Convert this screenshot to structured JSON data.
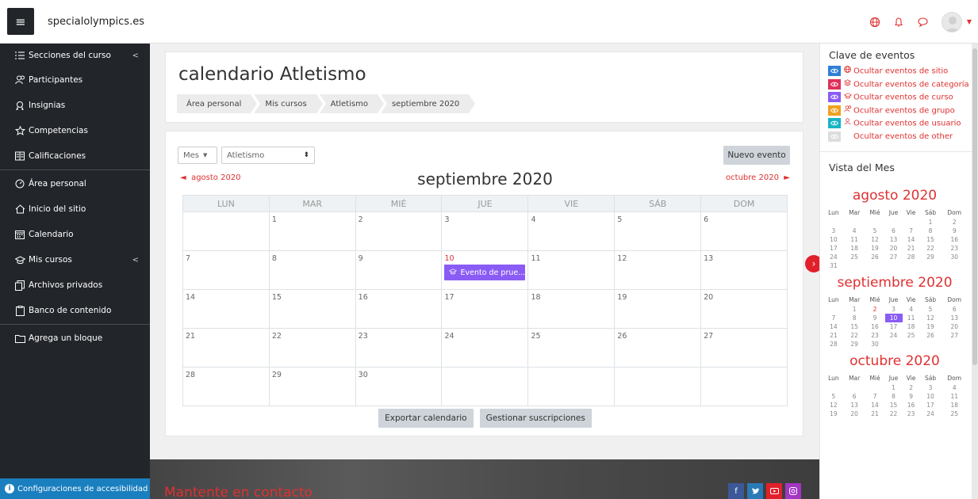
{
  "navbar": {
    "site_name": "specialolympics.es"
  },
  "sidebar": {
    "items": [
      {
        "label": "Secciones del curso",
        "icon": "list-icon",
        "chevron": "<"
      },
      {
        "label": "Participantes",
        "icon": "users-icon"
      },
      {
        "label": "Insignias",
        "icon": "badge-icon"
      },
      {
        "label": "Competencias",
        "icon": "star-icon"
      },
      {
        "label": "Calificaciones",
        "icon": "grades-icon"
      },
      {
        "label": "Área personal",
        "icon": "dashboard-icon"
      },
      {
        "label": "Inicio del sitio",
        "icon": "home-icon"
      },
      {
        "label": "Calendario",
        "icon": "calendar-icon"
      },
      {
        "label": "Mis cursos",
        "icon": "graduation-cap-icon",
        "chevron": "<"
      },
      {
        "label": "Archivos privados",
        "icon": "files-icon"
      },
      {
        "label": "Banco de contenido",
        "icon": "clipboard-icon"
      },
      {
        "label": "Agrega un bloque",
        "icon": "add-block-icon"
      }
    ],
    "accessibility_label": "Configuraciones de accesibilidad"
  },
  "header": {
    "title": "calendario Atletismo",
    "breadcrumb": [
      "Área personal",
      "Mis cursos",
      "Atletismo",
      "septiembre 2020"
    ]
  },
  "calendar": {
    "view_select": "Mes",
    "course_select": "Atletismo",
    "new_event_label": "Nuevo evento",
    "prev_month": "agosto 2020",
    "next_month": "octubre 2020",
    "month_title": "septiembre 2020",
    "weekdays": [
      "LUN",
      "MAR",
      "MIÉ",
      "JUE",
      "VIE",
      "SÁB",
      "DOM"
    ],
    "weeks": [
      [
        "",
        "1",
        "2",
        "3",
        "4",
        "5",
        "6"
      ],
      [
        "7",
        "8",
        "9",
        "10",
        "11",
        "12",
        "13"
      ],
      [
        "14",
        "15",
        "16",
        "17",
        "18",
        "19",
        "20"
      ],
      [
        "21",
        "22",
        "23",
        "24",
        "25",
        "26",
        "27"
      ],
      [
        "28",
        "29",
        "30",
        "",
        "",
        "",
        ""
      ]
    ],
    "event": {
      "day": "10",
      "label": "Evento de prue...",
      "color": "#8a5cf5"
    },
    "export_label": "Exportar calendario",
    "subscriptions_label": "Gestionar suscripciones"
  },
  "footer": {
    "title": "Mantente en contacto"
  },
  "event_key": {
    "title": "Clave de eventos",
    "items": [
      {
        "label": "Ocultar eventos de sitio",
        "color": "#2f7fd8",
        "icon": "globe-icon"
      },
      {
        "label": "Ocultar eventos de categoría",
        "color": "#e0305a",
        "icon": "category-icon"
      },
      {
        "label": "Ocultar eventos de curso",
        "color": "#8a5cf5",
        "icon": "graduation-cap-icon"
      },
      {
        "label": "Ocultar eventos de grupo",
        "color": "#f0a020",
        "icon": "users-icon"
      },
      {
        "label": "Ocultar eventos de usuario",
        "color": "#17b4c4",
        "icon": "user-icon"
      },
      {
        "label": "Ocultar eventos de other",
        "color": "#dddddd",
        "icon": ""
      }
    ]
  },
  "month_view": {
    "title": "Vista del Mes",
    "weekdays": [
      "Lun",
      "Mar",
      "Mié",
      "Jue",
      "Vie",
      "Sáb",
      "Dom"
    ],
    "months": [
      {
        "name": "agosto 2020",
        "weeks": [
          [
            "",
            "",
            "",
            "",
            "",
            "1",
            "2"
          ],
          [
            "3",
            "4",
            "5",
            "6",
            "7",
            "8",
            "9"
          ],
          [
            "10",
            "11",
            "12",
            "13",
            "14",
            "15",
            "16"
          ],
          [
            "17",
            "18",
            "19",
            "20",
            "21",
            "22",
            "23"
          ],
          [
            "24",
            "25",
            "26",
            "27",
            "28",
            "29",
            "30"
          ],
          [
            "31",
            "",
            "",
            "",
            "",
            "",
            ""
          ]
        ]
      },
      {
        "name": "septiembre 2020",
        "weeks": [
          [
            "",
            "1",
            "2",
            "3",
            "4",
            "5",
            "6"
          ],
          [
            "7",
            "8",
            "9",
            "10",
            "11",
            "12",
            "13"
          ],
          [
            "14",
            "15",
            "16",
            "17",
            "18",
            "19",
            "20"
          ],
          [
            "21",
            "22",
            "23",
            "24",
            "25",
            "26",
            "27"
          ],
          [
            "28",
            "29",
            "30",
            "",
            "",
            "",
            ""
          ]
        ],
        "highlight": "10",
        "today": "2"
      },
      {
        "name": "octubre 2020",
        "weeks": [
          [
            "",
            "",
            "",
            "1",
            "2",
            "3",
            "4"
          ],
          [
            "5",
            "6",
            "7",
            "8",
            "9",
            "10",
            "11"
          ],
          [
            "12",
            "13",
            "14",
            "15",
            "16",
            "17",
            "18"
          ],
          [
            "19",
            "20",
            "21",
            "22",
            "23",
            "24",
            "25"
          ]
        ]
      }
    ]
  },
  "colors": {
    "accent": "#e03030",
    "event": "#8a5cf5",
    "sidebar": "#22252a"
  }
}
